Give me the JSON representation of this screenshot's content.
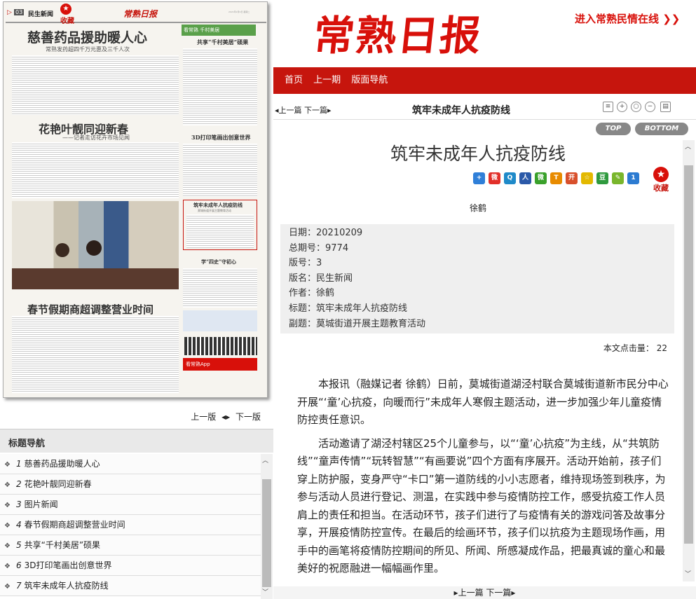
{
  "paper": {
    "section_no": "03",
    "section_name": "民生新闻",
    "fav_label": "收藏",
    "masthead": "常熟日报",
    "date_line": "2021年2月9日 星期二",
    "h1": "慈善药品援助暖人心",
    "h1_sub": "常熟发药超四千万元惠及三千人次",
    "h2": "花艳叶靓同迎新春",
    "h2_sub": "——记者走访花卉市场见闻",
    "h3": "春节假期商超调整营业时间",
    "r1_banner": "看常熟 千村美居",
    "r1": "共享“千村美居”硕果",
    "r2": "3D打印笔画出创意世界",
    "r3": "筑牢未成年人抗疫防线",
    "r3_sub": "莫城街道开展主题教育活动",
    "r4": "学“四史”守初心",
    "ad": "看常熟App"
  },
  "left_pager": {
    "prev": "上一版",
    "next": "下一版"
  },
  "nav": {
    "heading": "标题导航",
    "items": [
      {
        "num": "1",
        "title": "慈善药品援助暖人心"
      },
      {
        "num": "2",
        "title": "花艳叶靓同迎新春"
      },
      {
        "num": "3",
        "title": "图片新闻"
      },
      {
        "num": "4",
        "title": "春节假期商超调整营业时间"
      },
      {
        "num": "5",
        "title": "共享“千村美居”硕果"
      },
      {
        "num": "6",
        "title": "3D打印笔画出创意世界"
      },
      {
        "num": "7",
        "title": "筑牢未成年人抗疫防线"
      }
    ]
  },
  "site": {
    "logo": "常熟日报",
    "enter_link": "进入常熟民情在线 ❯❯",
    "menu": [
      "首页",
      "上一期",
      "版面导航"
    ]
  },
  "toolbar": {
    "prev": "上一篇",
    "next": "下一篇",
    "title": "筑牢未成年人抗疫防线",
    "top": "TOP",
    "bottom": "BOTTOM"
  },
  "article": {
    "title": "筑牢未成年人抗疫防线",
    "fav": "收藏",
    "byline": "徐鹤",
    "meta": [
      {
        "k": "日期：",
        "v": "20210209"
      },
      {
        "k": "总期号：",
        "v": "9774"
      },
      {
        "k": "版号：",
        "v": "3"
      },
      {
        "k": "版名：",
        "v": "民生新闻"
      },
      {
        "k": "作者：",
        "v": "徐鹤"
      },
      {
        "k": "标题：",
        "v": "筑牢未成年人抗疫防线"
      },
      {
        "k": "副题：",
        "v": "莫城街道开展主题教育活动"
      }
    ],
    "word_count": "本文点击量： 22",
    "paragraphs": [
      "本报讯（融媒记者 徐鹤）日前，莫城街道湖泾村联合莫城街道新市民分中心开展“‘童’心抗疫，向暖而行”未成年人寒假主题活动，进一步加强少年儿童疫情防控责任意识。",
      "活动邀请了湖泾村辖区25个儿童参与，以“‘童’心抗疫”为主线，从“共筑防线”“童声传情”“玩转智慧”“有画要说”四个方面有序展开。活动开始前，孩子们穿上防护服，变身严守“卡口”第一道防线的小小志愿者，维持现场签到秩序，为参与活动人员进行登记、测温，在实践中参与疫情防控工作，感受抗疫工作人员肩上的责任和担当。在活动环节，孩子们进行了与疫情有关的游戏问答及故事分享，开展疫情防控宣传。在最后的绘画环节，孩子们以抗疫为主题现场作画，用手中的画笔将疫情防控期间的所见、所闻、所感凝成作品，把最真诚的童心和最美好的祝愿融进一幅幅画作里。"
    ]
  },
  "bottom_pager": {
    "prev": "上一篇",
    "next": "下一篇"
  },
  "colors": {
    "brand_red": "#c6150d",
    "logo_red": "#d8100a"
  }
}
